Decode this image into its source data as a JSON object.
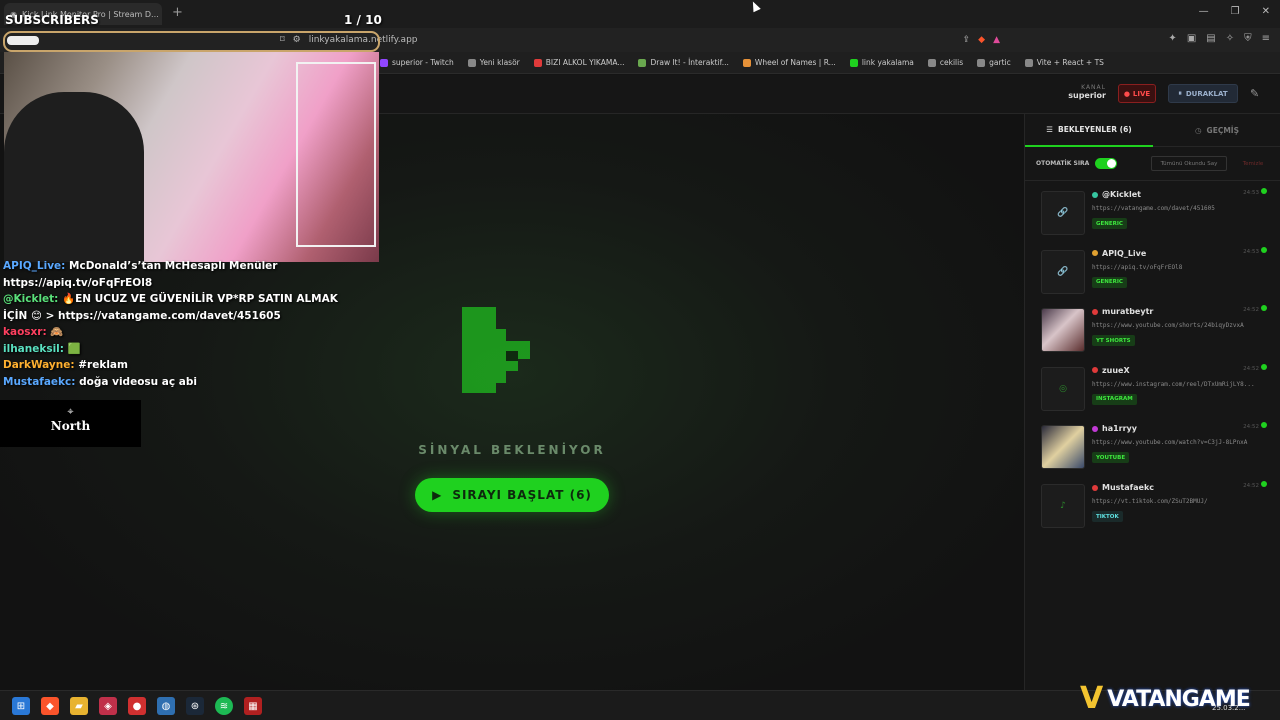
{
  "browser": {
    "tab_title": "Kick Link Monitor Pro | Stream D...",
    "url": "linkyakalama.netlify.app",
    "bookmarks": [
      {
        "label": "superior - Twitch",
        "color": "#9146ff"
      },
      {
        "label": "Yeni klasör",
        "color": "#888888"
      },
      {
        "label": "BIZI ALKOL YIKAMA...",
        "color": "#e03a3a"
      },
      {
        "label": "Draw It! - İnteraktif...",
        "color": "#6aa84f"
      },
      {
        "label": "Wheel of Names | R...",
        "color": "#e69138"
      },
      {
        "label": "link yakalama",
        "color": "#1fd11f"
      },
      {
        "label": "cekilis",
        "color": "#888888"
      },
      {
        "label": "gartic",
        "color": "#888888"
      },
      {
        "label": "Vite + React + TS",
        "color": "#888888"
      }
    ]
  },
  "header": {
    "kanal_label": "KANAL",
    "kanal_value": "superior",
    "live_label": "LIVE",
    "pause_label": "DURAKLAT"
  },
  "main": {
    "signal_text": "SİNYAL BEKLENİYOR",
    "start_label": "SIRAYI BAŞLAT (6)"
  },
  "sidebar": {
    "tab_waiting": "BEKLEYENLER (6)",
    "tab_history": "GEÇMİŞ",
    "auto_label": "OTOMATİK SIRA",
    "mark_all": "Tümünü Okundu Say",
    "clear": "Temizle",
    "queue": [
      {
        "user": "@Kicklet",
        "time": "24:53",
        "url": "https://vatangame.com/davet/451605",
        "badge": "GENERIC",
        "dot": "#36c5a0",
        "badge_bg": "#173d17",
        "badge_fg": "#3ee83e"
      },
      {
        "user": "APIQ_Live",
        "time": "24:53",
        "url": "https://apiq.tv/oFqFrEOl8",
        "badge": "GENERIC",
        "dot": "#e0a030",
        "badge_bg": "#173d17",
        "badge_fg": "#3ee83e"
      },
      {
        "user": "muratbeytr",
        "time": "24:52",
        "url": "https://www.youtube.com/shorts/24biqyDzvxA",
        "badge": "YT SHORTS",
        "dot": "#e03a3a",
        "badge_bg": "#173d17",
        "badge_fg": "#3ee83e"
      },
      {
        "user": "zuueX",
        "time": "24:52",
        "url": "https://www.instagram.com/reel/DTxUmRijLY8...",
        "badge": "INSTAGRAM",
        "dot": "#e03a3a",
        "badge_bg": "#173d17",
        "badge_fg": "#3ee83e"
      },
      {
        "user": "ha1rryy",
        "time": "24:52",
        "url": "https://www.youtube.com/watch?v=C3jJ-8LPnxA",
        "badge": "YOUTUBE",
        "dot": "#c23ad6",
        "badge_bg": "#173d17",
        "badge_fg": "#3ee83e"
      },
      {
        "user": "Mustafaekc",
        "time": "24:52",
        "url": "https://vt.tiktok.com/ZSuT2BMUJ/",
        "badge": "TIKTOK",
        "dot": "#e03a3a",
        "badge_bg": "#1a2a2a",
        "badge_fg": "#5ee0e0"
      }
    ]
  },
  "overlay": {
    "subscribers": "SUBSCRIBERS",
    "pager": "1  / 10",
    "chat": [
      {
        "user": "APIQ_Live:",
        "text": " McDonald’s’tan McHesaplı Menüler https://apiq.tv/oFqFrEOl8",
        "color": "#5aa8ff"
      },
      {
        "user": "@Kicklet:",
        "text": " 🔥EN UCUZ VE GÜVENİLİR VP*RP SATIN ALMAK İÇİN 😊 > https://vatangame.com/davet/451605",
        "color": "#5ae07a"
      },
      {
        "user": "kaosxr:",
        "text": " 🙈",
        "color": "#ff4060"
      },
      {
        "user": "ilhaneksil:",
        "text": " 🟩",
        "color": "#5ae0c0"
      },
      {
        "user": "DarkWayne:",
        "text": " #reklam",
        "color": "#ffb030"
      },
      {
        "user": "Mustafaekc:",
        "text": " doğa videosu aç abi",
        "color": "#5aa8ff"
      }
    ],
    "sponsor": "North"
  },
  "taskbar": {
    "brand_v": "V",
    "brand_text": "VATANGAME",
    "clock": "25.03.2..."
  }
}
